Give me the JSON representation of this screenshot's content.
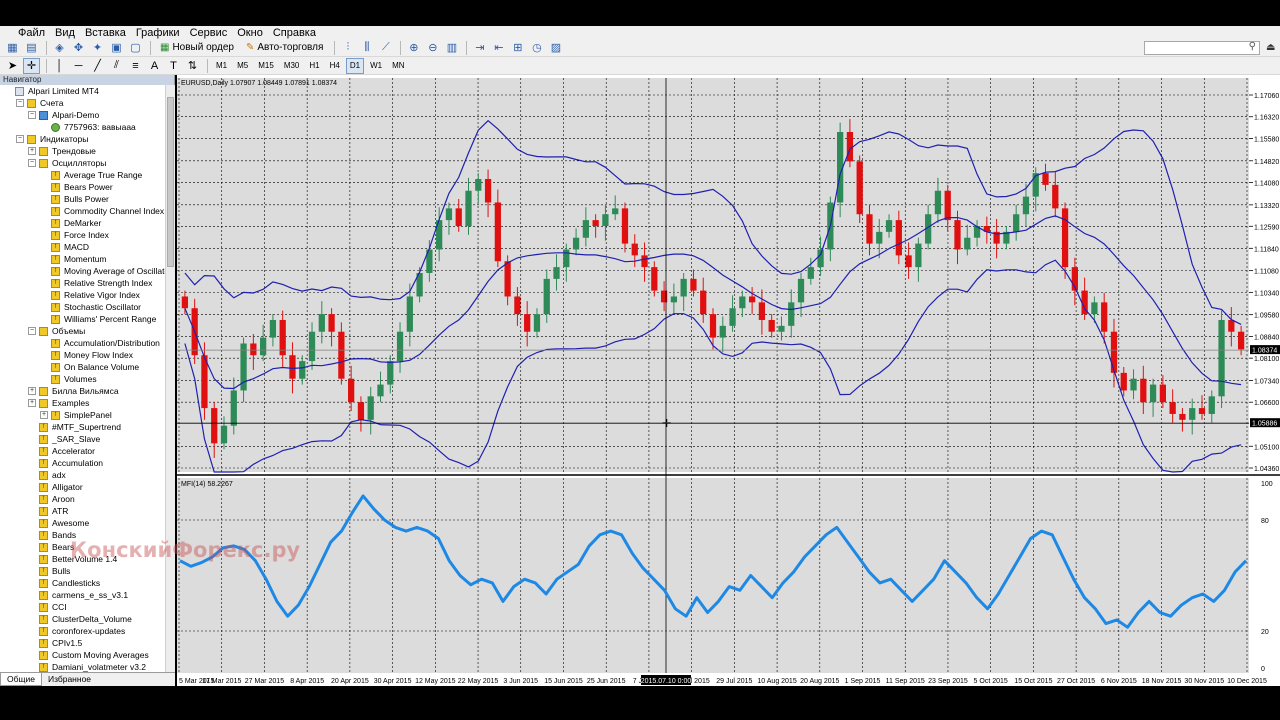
{
  "menu": [
    "Файл",
    "Вид",
    "Вставка",
    "Графики",
    "Сервис",
    "Окно",
    "Справка"
  ],
  "toolbar": {
    "new_order": "Новый ордер",
    "autotrading": "Авто-торговля",
    "timeframes": [
      "M1",
      "M5",
      "M15",
      "M30",
      "H1",
      "H4",
      "D1",
      "W1",
      "MN"
    ],
    "active_timeframe": "D1",
    "search_placeholder": ""
  },
  "navigator": {
    "title": "Навигатор",
    "tabs": [
      "Общие",
      "Избранное"
    ],
    "items": [
      {
        "label": "Alpari Limited MT4",
        "level": 0,
        "exp": "none",
        "icon": "terminal-icon"
      },
      {
        "label": "Счета",
        "level": 1,
        "exp": "-",
        "icon": "accounts-icon"
      },
      {
        "label": "Alpari-Demo",
        "level": 2,
        "exp": "-",
        "icon": "server-icon"
      },
      {
        "label": "7757963: вавыааа",
        "level": 3,
        "exp": "none",
        "icon": "user-icon"
      },
      {
        "label": "Индикаторы",
        "level": 1,
        "exp": "-",
        "icon": "folder-icon"
      },
      {
        "label": "Трендовые",
        "level": 2,
        "exp": "+",
        "icon": "folder-icon"
      },
      {
        "label": "Осцилляторы",
        "level": 2,
        "exp": "-",
        "icon": "folder-icon"
      },
      {
        "label": "Average True Range",
        "level": 3,
        "exp": "none",
        "icon": "indicator-icon"
      },
      {
        "label": "Bears Power",
        "level": 3,
        "exp": "none",
        "icon": "indicator-icon"
      },
      {
        "label": "Bulls Power",
        "level": 3,
        "exp": "none",
        "icon": "indicator-icon"
      },
      {
        "label": "Commodity Channel Index",
        "level": 3,
        "exp": "none",
        "icon": "indicator-icon"
      },
      {
        "label": "DeMarker",
        "level": 3,
        "exp": "none",
        "icon": "indicator-icon"
      },
      {
        "label": "Force Index",
        "level": 3,
        "exp": "none",
        "icon": "indicator-icon"
      },
      {
        "label": "MACD",
        "level": 3,
        "exp": "none",
        "icon": "indicator-icon"
      },
      {
        "label": "Momentum",
        "level": 3,
        "exp": "none",
        "icon": "indicator-icon"
      },
      {
        "label": "Moving Average of Oscillator",
        "level": 3,
        "exp": "none",
        "icon": "indicator-icon"
      },
      {
        "label": "Relative Strength Index",
        "level": 3,
        "exp": "none",
        "icon": "indicator-icon"
      },
      {
        "label": "Relative Vigor Index",
        "level": 3,
        "exp": "none",
        "icon": "indicator-icon"
      },
      {
        "label": "Stochastic Oscillator",
        "level": 3,
        "exp": "none",
        "icon": "indicator-icon"
      },
      {
        "label": "Williams' Percent Range",
        "level": 3,
        "exp": "none",
        "icon": "indicator-icon"
      },
      {
        "label": "Объемы",
        "level": 2,
        "exp": "-",
        "icon": "folder-icon"
      },
      {
        "label": "Accumulation/Distribution",
        "level": 3,
        "exp": "none",
        "icon": "indicator-icon"
      },
      {
        "label": "Money Flow Index",
        "level": 3,
        "exp": "none",
        "icon": "indicator-icon"
      },
      {
        "label": "On Balance Volume",
        "level": 3,
        "exp": "none",
        "icon": "indicator-icon"
      },
      {
        "label": "Volumes",
        "level": 3,
        "exp": "none",
        "icon": "indicator-icon"
      },
      {
        "label": "Билла Вильямса",
        "level": 2,
        "exp": "+",
        "icon": "folder-icon"
      },
      {
        "label": "Examples",
        "level": 2,
        "exp": "+",
        "icon": "folder-icon"
      },
      {
        "label": "SimplePanel",
        "level": 3,
        "exp": "+",
        "icon": "indicator-icon"
      },
      {
        "label": "#MTF_Supertrend",
        "level": 2,
        "exp": "none",
        "icon": "indicator-icon"
      },
      {
        "label": "_SAR_Slave",
        "level": 2,
        "exp": "none",
        "icon": "indicator-icon"
      },
      {
        "label": "Accelerator",
        "level": 2,
        "exp": "none",
        "icon": "indicator-icon"
      },
      {
        "label": "Accumulation",
        "level": 2,
        "exp": "none",
        "icon": "indicator-icon"
      },
      {
        "label": "adx",
        "level": 2,
        "exp": "none",
        "icon": "indicator-icon"
      },
      {
        "label": "Alligator",
        "level": 2,
        "exp": "none",
        "icon": "indicator-icon"
      },
      {
        "label": "Aroon",
        "level": 2,
        "exp": "none",
        "icon": "indicator-icon"
      },
      {
        "label": "ATR",
        "level": 2,
        "exp": "none",
        "icon": "indicator-icon"
      },
      {
        "label": "Awesome",
        "level": 2,
        "exp": "none",
        "icon": "indicator-icon"
      },
      {
        "label": "Bands",
        "level": 2,
        "exp": "none",
        "icon": "indicator-icon"
      },
      {
        "label": "Bears",
        "level": 2,
        "exp": "none",
        "icon": "indicator-icon"
      },
      {
        "label": "BetterVolume 1.4",
        "level": 2,
        "exp": "none",
        "icon": "indicator-icon"
      },
      {
        "label": "Bulls",
        "level": 2,
        "exp": "none",
        "icon": "indicator-icon"
      },
      {
        "label": "Candlesticks",
        "level": 2,
        "exp": "none",
        "icon": "indicator-icon"
      },
      {
        "label": "carmens_e_ss_v3.1",
        "level": 2,
        "exp": "none",
        "icon": "indicator-icon"
      },
      {
        "label": "CCI",
        "level": 2,
        "exp": "none",
        "icon": "indicator-icon"
      },
      {
        "label": "ClusterDelta_Volume",
        "level": 2,
        "exp": "none",
        "icon": "indicator-icon"
      },
      {
        "label": "coronforex-updates",
        "level": 2,
        "exp": "none",
        "icon": "indicator-icon"
      },
      {
        "label": "CPIv1.5",
        "level": 2,
        "exp": "none",
        "icon": "indicator-icon"
      },
      {
        "label": "Custom Moving Averages",
        "level": 2,
        "exp": "none",
        "icon": "indicator-icon"
      },
      {
        "label": "Damiani_volatmeter v3.2",
        "level": 2,
        "exp": "none",
        "icon": "indicator-icon"
      }
    ]
  },
  "watermark": "КонскийФорекс.ру",
  "colors": {
    "bull": "#2e8b57",
    "bear": "#e01010",
    "band": "#2020b0",
    "mfi": "#1e88e5",
    "grid": "#000000"
  },
  "chart_data": {
    "type": "candlestick",
    "symbol_header": "EURUSD,Daily  1.07907 1.08449 1.07891 1.08374",
    "price_labels": [
      "1.17060",
      "1.16320",
      "1.15580",
      "1.14820",
      "1.14080",
      "1.13320",
      "1.12590",
      "1.11840",
      "1.11080",
      "1.10340",
      "1.09580",
      "1.08840",
      "1.08100",
      "1.07340",
      "1.06600",
      "1.05100",
      "1.04360"
    ],
    "price_ylim": [
      1.0436,
      1.1706
    ],
    "current_price_label": "1.08374",
    "crosshair_price_label": "1.05886",
    "crosshair_time_label": "2015.07.10 0:00",
    "date_labels": [
      "5 Mar 2015",
      "17 Mar 2015",
      "27 Mar 2015",
      "8 Apr 2015",
      "20 Apr 2015",
      "30 Apr 2015",
      "12 May 2015",
      "22 May 2015",
      "3 Jun 2015",
      "15 Jun 2015",
      "25 Jun 2015",
      "7 Jul 2015",
      "17 Jul 2015",
      "29 Jul 2015",
      "10 Aug 2015",
      "20 Aug 2015",
      "1 Sep 2015",
      "11 Sep 2015",
      "23 Sep 2015",
      "5 Oct 2015",
      "15 Oct 2015",
      "27 Oct 2015",
      "6 Nov 2015",
      "18 Nov 2015",
      "30 Nov 2015",
      "10 Dec 2015"
    ],
    "close_path": [
      1.098,
      1.082,
      1.064,
      1.052,
      1.058,
      1.07,
      1.086,
      1.082,
      1.088,
      1.094,
      1.082,
      1.074,
      1.08,
      1.09,
      1.096,
      1.09,
      1.074,
      1.066,
      1.06,
      1.068,
      1.072,
      1.08,
      1.09,
      1.102,
      1.11,
      1.118,
      1.128,
      1.132,
      1.126,
      1.138,
      1.142,
      1.134,
      1.114,
      1.102,
      1.096,
      1.09,
      1.096,
      1.108,
      1.112,
      1.118,
      1.122,
      1.128,
      1.126,
      1.13,
      1.132,
      1.12,
      1.116,
      1.112,
      1.104,
      1.1,
      1.102,
      1.108,
      1.104,
      1.096,
      1.088,
      1.092,
      1.098,
      1.102,
      1.1,
      1.094,
      1.09,
      1.092,
      1.1,
      1.108,
      1.112,
      1.118,
      1.134,
      1.158,
      1.148,
      1.13,
      1.12,
      1.124,
      1.128,
      1.116,
      1.112,
      1.12,
      1.13,
      1.138,
      1.128,
      1.118,
      1.122,
      1.126,
      1.124,
      1.12,
      1.124,
      1.13,
      1.136,
      1.144,
      1.14,
      1.132,
      1.112,
      1.104,
      1.096,
      1.1,
      1.09,
      1.076,
      1.07,
      1.074,
      1.066,
      1.072,
      1.066,
      1.062,
      1.06,
      1.064,
      1.062,
      1.068,
      1.094,
      1.09,
      1.084
    ],
    "indicator": {
      "name": "MFI(14) 58.2267",
      "ylim": [
        0,
        100
      ],
      "levels": [
        20,
        80
      ],
      "tick_labels": [
        "100",
        "80",
        "20",
        "0"
      ],
      "values": [
        58,
        55,
        57,
        60,
        65,
        66,
        64,
        58,
        48,
        36,
        28,
        34,
        44,
        56,
        68,
        74,
        84,
        93,
        86,
        80,
        76,
        74,
        76,
        74,
        70,
        58,
        50,
        45,
        48,
        46,
        36,
        44,
        48,
        46,
        40,
        48,
        52,
        56,
        66,
        72,
        74,
        72,
        62,
        54,
        48,
        42,
        32,
        28,
        38,
        30,
        36,
        44,
        42,
        50,
        44,
        38,
        46,
        52,
        60,
        66,
        72,
        76,
        68,
        60,
        52,
        46,
        48,
        42,
        36,
        42,
        48,
        58,
        52,
        46,
        38,
        32,
        40,
        50,
        60,
        70,
        74,
        72,
        60,
        48,
        38,
        32,
        24,
        26,
        22,
        30,
        36,
        30,
        28,
        34,
        38,
        40,
        36,
        42,
        52,
        58
      ]
    }
  }
}
